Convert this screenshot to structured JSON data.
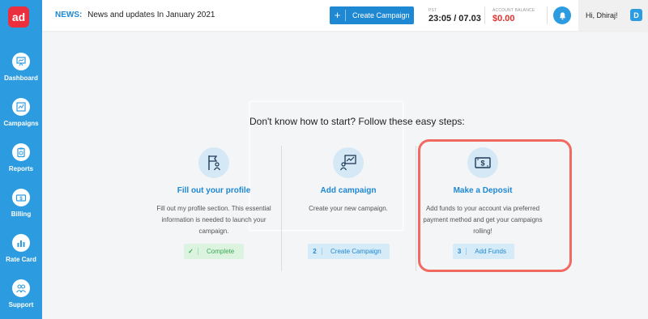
{
  "app": {
    "logo_text": "ad"
  },
  "sidebar": {
    "items": [
      {
        "label": "Dashboard",
        "icon": "presentation-board-icon"
      },
      {
        "label": "Campaigns",
        "icon": "chart-icon"
      },
      {
        "label": "Reports",
        "icon": "clipboard-icon"
      },
      {
        "label": "Billing",
        "icon": "money-icon"
      },
      {
        "label": "Rate Card",
        "icon": "bar-chart-icon"
      },
      {
        "label": "Support",
        "icon": "people-icon"
      }
    ]
  },
  "header": {
    "news_label": "NEWS:",
    "news_text": "News and updates In January 2021",
    "create_campaign_label": "Create Campaign",
    "create_campaign_plus": "+",
    "pst_label": "PST",
    "pst_value": "23:05 / 07.03",
    "balance_label": "ACCOUNT BALANCE",
    "balance_value": "$0.00",
    "greeting": "Hi, Dhiraj!",
    "avatar_initial": "D"
  },
  "main": {
    "headline": "Don't know how to start? Follow these easy steps:",
    "steps": [
      {
        "title": "Fill out your profile",
        "description": "Fill out my profile section. This essential information is needed to launch your campaign.",
        "button_number": "✓",
        "button_label": "Complete"
      },
      {
        "title": "Add campaign",
        "description": "Create your new campaign.",
        "button_number": "2",
        "button_label": "Create Campaign"
      },
      {
        "title": "Make a Deposit",
        "description": "Add funds to your account via preferred payment method and get your campaigns rolling!",
        "button_number": "3",
        "button_label": "Add Funds"
      }
    ]
  },
  "colors": {
    "primary": "#1e88d3",
    "sidebar": "#2d9bdf",
    "balance": "#e0322f",
    "complete": "#3aaa55",
    "highlight": "#f06a62"
  }
}
